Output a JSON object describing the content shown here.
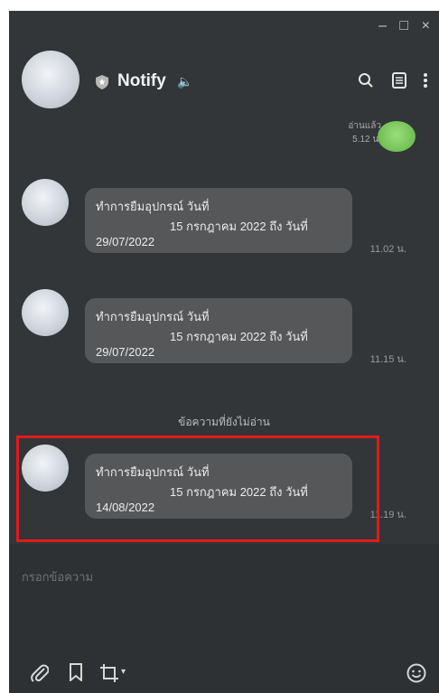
{
  "window": {
    "controls": {
      "minimize": "–",
      "maximize": "□",
      "close": "×"
    }
  },
  "header": {
    "chat_name": "Notify",
    "icons": [
      "shield-icon",
      "speaker-icon",
      "search-icon",
      "notes-icon",
      "more-icon"
    ]
  },
  "messages": {
    "sent": {
      "read_label": "อ่านแล้ว",
      "time": "5.12 น."
    },
    "received": [
      {
        "line1": "ทำการยืมอุปกรณ์ วันที่",
        "line2": "15 กรกฎาคม 2022 ถึง วันที่",
        "line3": "29/07/2022",
        "time": "11.02 น."
      },
      {
        "line1": "ทำการยืมอุปกรณ์ วันที่",
        "line2": "15 กรกฎาคม 2022 ถึง วันที่",
        "line3": "29/07/2022",
        "time": "11.15 น."
      },
      {
        "line1": "ทำการยืมอุปกรณ์ วันที่",
        "line2": "15 กรกฎาคม 2022 ถึง วันที่",
        "line3": "14/08/2022",
        "time": "11.19 น."
      }
    ],
    "unread_divider": "ข้อความที่ยังไม่อ่าน"
  },
  "input": {
    "placeholder": "กรอกข้อความ"
  },
  "toolbar": {
    "icons": [
      "paperclip-icon",
      "bookmark-icon",
      "crop-icon",
      "emoji-icon"
    ],
    "crop_dropdown": "▾"
  },
  "colors": {
    "highlight": "#e21a1a",
    "bubble": "#555759",
    "background": "#333638"
  }
}
